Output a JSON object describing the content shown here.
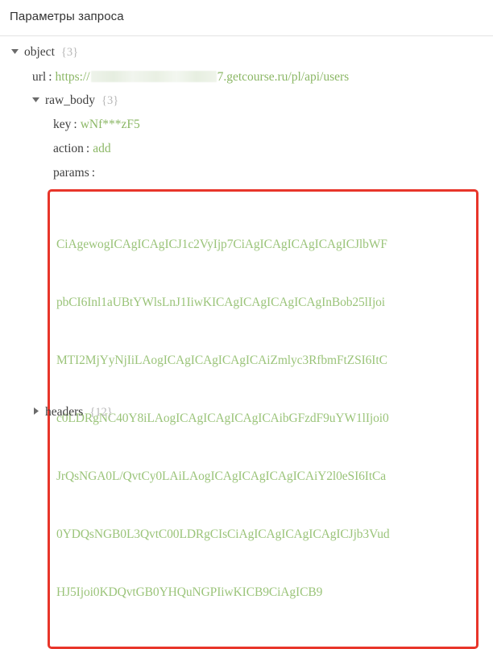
{
  "panel": {
    "title": "Параметры запроса"
  },
  "tree": {
    "root": {
      "label": "object",
      "count": "{3}",
      "expanded": true,
      "twisty": "chevron-down-icon"
    },
    "url": {
      "key": "url",
      "separator": ":",
      "value_prefix": "https://",
      "value_redacted": "[blurred]",
      "value_suffix": "7.getcourse.ru/pl/api/users"
    },
    "raw_body": {
      "label": "raw_body",
      "count": "{3}",
      "expanded": true,
      "twisty": "chevron-down-icon",
      "fields": [
        {
          "key": "key",
          "separator": ":",
          "value": "wNf***zF5"
        },
        {
          "key": "action",
          "separator": ":",
          "value": "add"
        },
        {
          "key": "params",
          "separator": ":",
          "value": ""
        }
      ]
    },
    "headers": {
      "label": "headers",
      "count": "{12}",
      "expanded": false,
      "twisty": "chevron-right-icon"
    }
  },
  "params_block": {
    "highlight_color": "#e8352a",
    "text_color": "#9bc47a",
    "lines": [
      "CiAgewogICAgICAgICJ1c2VyIjp7CiAgICAgICAgICAgICJlbWF",
      "pbCI6Inl1aUBtYWlsLnJ1IiwKICAgICAgICAgICAgInBob25lIjoi",
      "MTI2MjYyNjIiLAogICAgICAgICAgICAiZmlyc3RfbmFtZSI6ItC",
      "c0LDRgNC40Y8iLAogICAgICAgICAgICAibGFzdF9uYW1lIjoi0",
      "JrQsNGA0L/QvtCy0LAiLAogICAgICAgICAgICAiY2l0eSI6ItCa",
      "0YDQsNGB0L3QvtC00LDRgCIsCiAgICAgICAgICAgICJjb3Vud",
      "HJ5Ijoi0KDQvtGB0YHQuNGPIiwKICB9CiAgICB9"
    ]
  }
}
